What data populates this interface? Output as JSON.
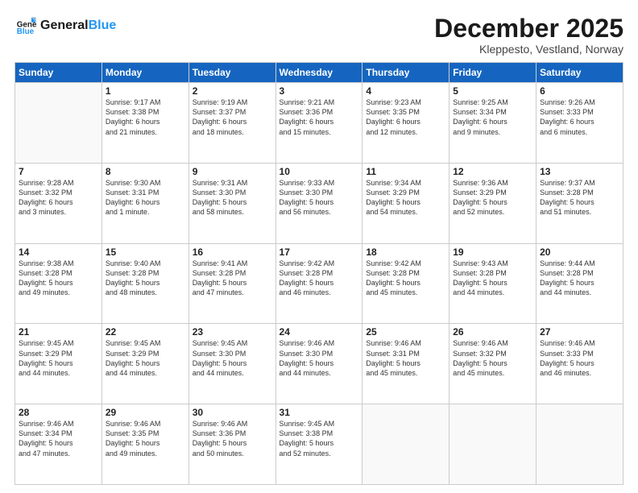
{
  "logo": {
    "line1": "General",
    "line2": "Blue"
  },
  "title": "December 2025",
  "subtitle": "Kleppesto, Vestland, Norway",
  "header_days": [
    "Sunday",
    "Monday",
    "Tuesday",
    "Wednesday",
    "Thursday",
    "Friday",
    "Saturday"
  ],
  "weeks": [
    [
      {
        "day": "",
        "info": ""
      },
      {
        "day": "1",
        "info": "Sunrise: 9:17 AM\nSunset: 3:38 PM\nDaylight: 6 hours\nand 21 minutes."
      },
      {
        "day": "2",
        "info": "Sunrise: 9:19 AM\nSunset: 3:37 PM\nDaylight: 6 hours\nand 18 minutes."
      },
      {
        "day": "3",
        "info": "Sunrise: 9:21 AM\nSunset: 3:36 PM\nDaylight: 6 hours\nand 15 minutes."
      },
      {
        "day": "4",
        "info": "Sunrise: 9:23 AM\nSunset: 3:35 PM\nDaylight: 6 hours\nand 12 minutes."
      },
      {
        "day": "5",
        "info": "Sunrise: 9:25 AM\nSunset: 3:34 PM\nDaylight: 6 hours\nand 9 minutes."
      },
      {
        "day": "6",
        "info": "Sunrise: 9:26 AM\nSunset: 3:33 PM\nDaylight: 6 hours\nand 6 minutes."
      }
    ],
    [
      {
        "day": "7",
        "info": "Sunrise: 9:28 AM\nSunset: 3:32 PM\nDaylight: 6 hours\nand 3 minutes."
      },
      {
        "day": "8",
        "info": "Sunrise: 9:30 AM\nSunset: 3:31 PM\nDaylight: 6 hours\nand 1 minute."
      },
      {
        "day": "9",
        "info": "Sunrise: 9:31 AM\nSunset: 3:30 PM\nDaylight: 5 hours\nand 58 minutes."
      },
      {
        "day": "10",
        "info": "Sunrise: 9:33 AM\nSunset: 3:30 PM\nDaylight: 5 hours\nand 56 minutes."
      },
      {
        "day": "11",
        "info": "Sunrise: 9:34 AM\nSunset: 3:29 PM\nDaylight: 5 hours\nand 54 minutes."
      },
      {
        "day": "12",
        "info": "Sunrise: 9:36 AM\nSunset: 3:29 PM\nDaylight: 5 hours\nand 52 minutes."
      },
      {
        "day": "13",
        "info": "Sunrise: 9:37 AM\nSunset: 3:28 PM\nDaylight: 5 hours\nand 51 minutes."
      }
    ],
    [
      {
        "day": "14",
        "info": "Sunrise: 9:38 AM\nSunset: 3:28 PM\nDaylight: 5 hours\nand 49 minutes."
      },
      {
        "day": "15",
        "info": "Sunrise: 9:40 AM\nSunset: 3:28 PM\nDaylight: 5 hours\nand 48 minutes."
      },
      {
        "day": "16",
        "info": "Sunrise: 9:41 AM\nSunset: 3:28 PM\nDaylight: 5 hours\nand 47 minutes."
      },
      {
        "day": "17",
        "info": "Sunrise: 9:42 AM\nSunset: 3:28 PM\nDaylight: 5 hours\nand 46 minutes."
      },
      {
        "day": "18",
        "info": "Sunrise: 9:42 AM\nSunset: 3:28 PM\nDaylight: 5 hours\nand 45 minutes."
      },
      {
        "day": "19",
        "info": "Sunrise: 9:43 AM\nSunset: 3:28 PM\nDaylight: 5 hours\nand 44 minutes."
      },
      {
        "day": "20",
        "info": "Sunrise: 9:44 AM\nSunset: 3:28 PM\nDaylight: 5 hours\nand 44 minutes."
      }
    ],
    [
      {
        "day": "21",
        "info": "Sunrise: 9:45 AM\nSunset: 3:29 PM\nDaylight: 5 hours\nand 44 minutes."
      },
      {
        "day": "22",
        "info": "Sunrise: 9:45 AM\nSunset: 3:29 PM\nDaylight: 5 hours\nand 44 minutes."
      },
      {
        "day": "23",
        "info": "Sunrise: 9:45 AM\nSunset: 3:30 PM\nDaylight: 5 hours\nand 44 minutes."
      },
      {
        "day": "24",
        "info": "Sunrise: 9:46 AM\nSunset: 3:30 PM\nDaylight: 5 hours\nand 44 minutes."
      },
      {
        "day": "25",
        "info": "Sunrise: 9:46 AM\nSunset: 3:31 PM\nDaylight: 5 hours\nand 45 minutes."
      },
      {
        "day": "26",
        "info": "Sunrise: 9:46 AM\nSunset: 3:32 PM\nDaylight: 5 hours\nand 45 minutes."
      },
      {
        "day": "27",
        "info": "Sunrise: 9:46 AM\nSunset: 3:33 PM\nDaylight: 5 hours\nand 46 minutes."
      }
    ],
    [
      {
        "day": "28",
        "info": "Sunrise: 9:46 AM\nSunset: 3:34 PM\nDaylight: 5 hours\nand 47 minutes."
      },
      {
        "day": "29",
        "info": "Sunrise: 9:46 AM\nSunset: 3:35 PM\nDaylight: 5 hours\nand 49 minutes."
      },
      {
        "day": "30",
        "info": "Sunrise: 9:46 AM\nSunset: 3:36 PM\nDaylight: 5 hours\nand 50 minutes."
      },
      {
        "day": "31",
        "info": "Sunrise: 9:45 AM\nSunset: 3:38 PM\nDaylight: 5 hours\nand 52 minutes."
      },
      {
        "day": "",
        "info": ""
      },
      {
        "day": "",
        "info": ""
      },
      {
        "day": "",
        "info": ""
      }
    ]
  ]
}
